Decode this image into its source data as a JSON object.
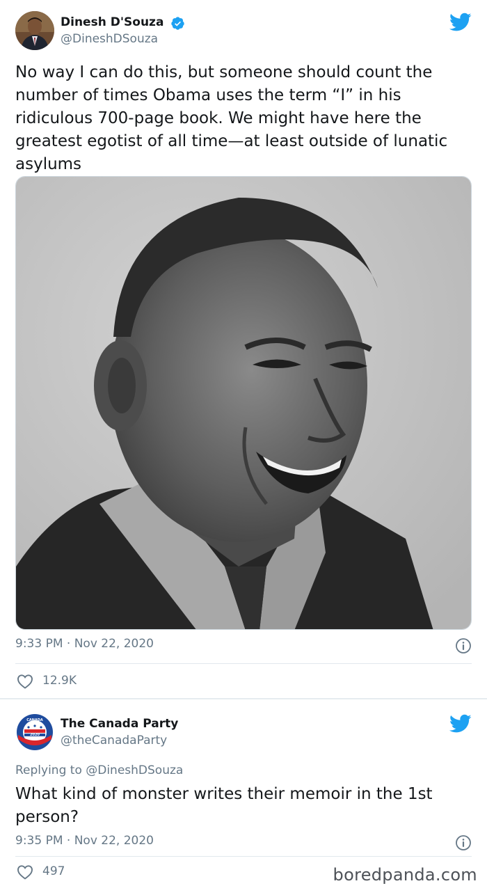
{
  "tweet1": {
    "author_name": "Dinesh D'Souza",
    "author_handle": "@DineshDSouza",
    "text": "No way I can do this, but someone should count the number of times Obama uses the term “I” in his ridiculous 700-page book. We might have here the greatest egotist of all time—at least outside of lunatic asylums",
    "timestamp": "9:33 PM · Nov 22, 2020",
    "likes": "12.9K"
  },
  "tweet2": {
    "author_name": "The Canada Party",
    "author_handle": "@theCanadaParty",
    "replying_to": "Replying to @DineshDSouza",
    "text": "What kind of monster writes their memoir in the 1st person?",
    "timestamp": "9:35 PM · Nov 22, 2020",
    "likes": "497",
    "avatar_seal_text": "CANADA FOR PRESIDENT 2020 THE CANADA PARTY"
  },
  "watermark": "boredpanda.com",
  "colors": {
    "twitter_blue": "#1DA1F2",
    "text_primary": "#14171A",
    "text_secondary": "#657786",
    "divider": "#E1E8ED"
  },
  "icons": [
    "verified-badge-icon",
    "twitter-bird-icon",
    "info-icon",
    "heart-icon"
  ]
}
